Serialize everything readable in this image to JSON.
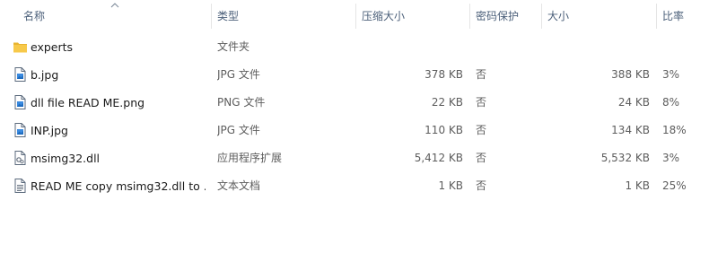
{
  "columns": {
    "name": "名称",
    "type": "类型",
    "compressed_size": "压缩大小",
    "password_protected": "密码保护",
    "size": "大小",
    "ratio": "比率"
  },
  "files": [
    {
      "name": "experts",
      "type": "文件夹",
      "compressed_size": "",
      "password_protected": "",
      "size": "",
      "ratio": "",
      "icon": "folder-icon"
    },
    {
      "name": "b.jpg",
      "type": "JPG 文件",
      "compressed_size": "378 KB",
      "password_protected": "否",
      "size": "388 KB",
      "ratio": "3%",
      "icon": "image-file-icon"
    },
    {
      "name": "dll file READ ME.png",
      "type": "PNG 文件",
      "compressed_size": "22 KB",
      "password_protected": "否",
      "size": "24 KB",
      "ratio": "8%",
      "icon": "image-file-icon"
    },
    {
      "name": "INP.jpg",
      "type": "JPG 文件",
      "compressed_size": "110 KB",
      "password_protected": "否",
      "size": "134 KB",
      "ratio": "18%",
      "icon": "image-file-icon"
    },
    {
      "name": "msimg32.dll",
      "type": "应用程序扩展",
      "compressed_size": "5,412 KB",
      "password_protected": "否",
      "size": "5,532 KB",
      "ratio": "3%",
      "icon": "dll-file-icon"
    },
    {
      "name": "READ ME copy msimg32.dll to ...",
      "type": "文本文档",
      "compressed_size": "1 KB",
      "password_protected": "否",
      "size": "1 KB",
      "ratio": "25%",
      "icon": "text-file-icon"
    }
  ]
}
